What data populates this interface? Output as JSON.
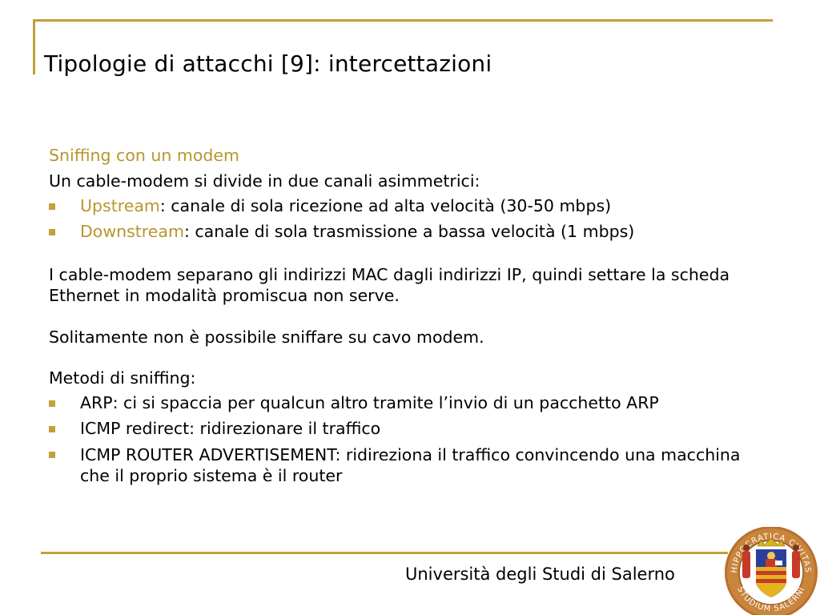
{
  "slide": {
    "title": "Tipologie di attacchi [9]: intercettazioni",
    "section_heading": "Sniffing con un modem",
    "intro": "Un cable-modem si divide in due canali asimmetrici:",
    "channels": [
      {
        "term": "Upstream",
        "text": ": canale di sola ricezione ad alta velocità (30-50 mbps)"
      },
      {
        "term": "Downstream",
        "text": ": canale di sola trasmissione a bassa velocità (1 mbps)"
      }
    ],
    "paragraph_mac": "I cable-modem separano gli indirizzi MAC dagli indirizzi IP, quindi settare la scheda Ethernet in modalità promiscua non serve.",
    "paragraph_modem": "Solitamente non è possibile sniffare su cavo modem.",
    "methods_heading": "Metodi di sniffing:",
    "methods": [
      "ARP: ci si spaccia per qualcun altro tramite l’invio di un pacchetto ARP",
      "ICMP redirect: ridirezionare il traffico",
      "ICMP ROUTER ADVERTISEMENT: ridireziona il traffico convincendo una macchina che il proprio sistema è il router"
    ]
  },
  "footer": {
    "institution": "Università degli Studi di Salerno",
    "seal_text_top": "HIPPOCRATICA CIVITAS",
    "seal_text_bottom": "STUDIUM SALERNI"
  },
  "colors": {
    "accent_gold": "#c2a03a",
    "heading_gold": "#b8962e",
    "text": "#000000"
  }
}
